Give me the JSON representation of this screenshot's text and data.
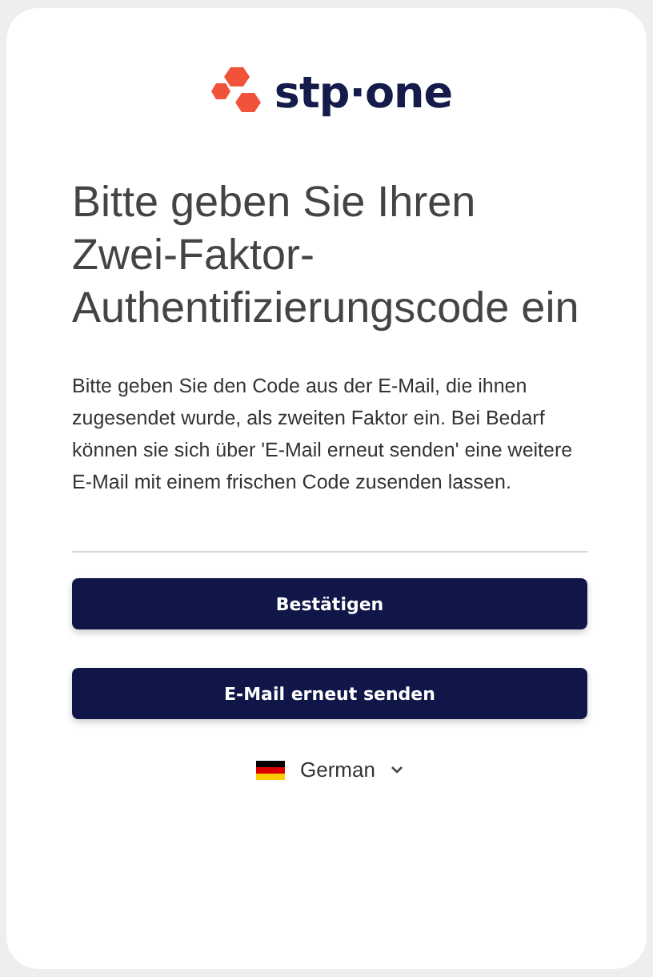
{
  "logo": {
    "text": "stp·one"
  },
  "title": "Bitte geben Sie Ihren Zwei-Faktor-Authentifizierungscode ein",
  "description": "Bitte geben Sie den Code aus der E-Mail, die ihnen zugesendet wurde, als zweiten Faktor ein. Bei Bedarf können sie sich über 'E-Mail erneut senden' eine weitere E-Mail mit einem frischen Code zusenden lassen.",
  "buttons": [
    {
      "label": "Bestätigen"
    },
    {
      "label": "E-Mail erneut senden"
    }
  ],
  "language": {
    "label": "German"
  }
}
